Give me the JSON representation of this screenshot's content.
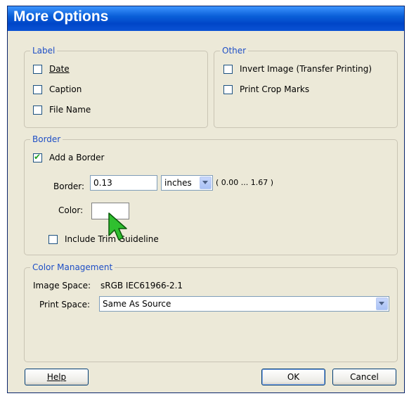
{
  "dialog": {
    "title": "More Options"
  },
  "label_group": {
    "legend": "Label",
    "date": {
      "label": "Date",
      "checked": false
    },
    "caption": {
      "label": "Caption",
      "checked": false
    },
    "file_name": {
      "label": "File Name",
      "checked": false
    }
  },
  "other_group": {
    "legend": "Other",
    "invert_image": {
      "label": "Invert Image (Transfer Printing)",
      "checked": false
    },
    "print_crop_marks": {
      "label": "Print Crop Marks",
      "checked": false
    }
  },
  "border_group": {
    "legend": "Border",
    "add_border": {
      "label": "Add a Border",
      "checked": true
    },
    "border_label": "Border:",
    "border_value": "0.13",
    "units": "inches",
    "range": "( 0.00 ... 1.67 )",
    "color_label": "Color:",
    "color_value": "#ffffff",
    "include_trim": {
      "label": "Include Trim Guideline",
      "checked": false
    }
  },
  "color_management": {
    "legend": "Color Management",
    "image_space_label": "Image Space:",
    "image_space_value": "sRGB IEC61966-2.1",
    "print_space_label": "Print Space:",
    "print_space_value": "Same As Source"
  },
  "buttons": {
    "help": "Help",
    "ok": "OK",
    "cancel": "Cancel"
  },
  "colors": {
    "title_bar": "#0a5fd8",
    "dialog_bg": "#ece9d8",
    "legend_text": "#1f4fc6",
    "cursor": "#2fbf2f"
  },
  "icons": {
    "cursor": "green-arrow-cursor-icon"
  }
}
